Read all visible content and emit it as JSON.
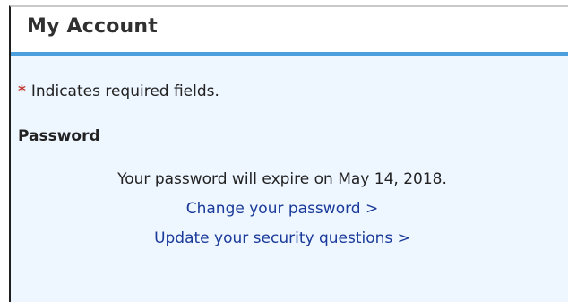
{
  "account": {
    "title": "My Account",
    "required_marker": "*",
    "required_text": "Indicates required fields.",
    "password_heading": "Password",
    "expire_text": "Your password will expire on May 14, 2018.",
    "change_password_link": "Change your password >",
    "security_questions_link": "Update your security questions >"
  },
  "colors": {
    "accent": "#4a9fdc",
    "panel_bg": "#eef6ff",
    "link": "#1a3a9a",
    "required": "#c0392b"
  }
}
